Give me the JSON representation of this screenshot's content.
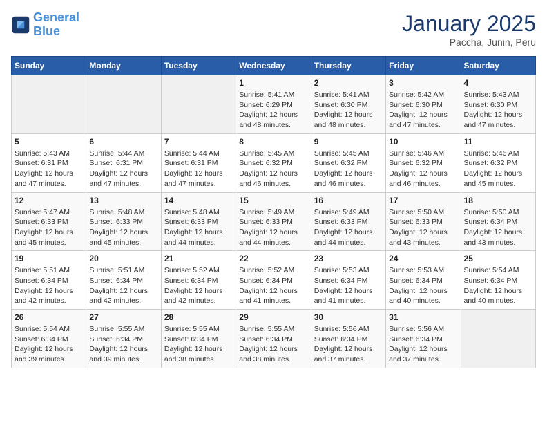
{
  "header": {
    "logo_line1": "General",
    "logo_line2": "Blue",
    "month": "January 2025",
    "location": "Paccha, Junin, Peru"
  },
  "days_of_week": [
    "Sunday",
    "Monday",
    "Tuesday",
    "Wednesday",
    "Thursday",
    "Friday",
    "Saturday"
  ],
  "weeks": [
    [
      {
        "num": "",
        "info": ""
      },
      {
        "num": "",
        "info": ""
      },
      {
        "num": "",
        "info": ""
      },
      {
        "num": "1",
        "info": "Sunrise: 5:41 AM\nSunset: 6:29 PM\nDaylight: 12 hours\nand 48 minutes."
      },
      {
        "num": "2",
        "info": "Sunrise: 5:41 AM\nSunset: 6:30 PM\nDaylight: 12 hours\nand 48 minutes."
      },
      {
        "num": "3",
        "info": "Sunrise: 5:42 AM\nSunset: 6:30 PM\nDaylight: 12 hours\nand 47 minutes."
      },
      {
        "num": "4",
        "info": "Sunrise: 5:43 AM\nSunset: 6:30 PM\nDaylight: 12 hours\nand 47 minutes."
      }
    ],
    [
      {
        "num": "5",
        "info": "Sunrise: 5:43 AM\nSunset: 6:31 PM\nDaylight: 12 hours\nand 47 minutes."
      },
      {
        "num": "6",
        "info": "Sunrise: 5:44 AM\nSunset: 6:31 PM\nDaylight: 12 hours\nand 47 minutes."
      },
      {
        "num": "7",
        "info": "Sunrise: 5:44 AM\nSunset: 6:31 PM\nDaylight: 12 hours\nand 47 minutes."
      },
      {
        "num": "8",
        "info": "Sunrise: 5:45 AM\nSunset: 6:32 PM\nDaylight: 12 hours\nand 46 minutes."
      },
      {
        "num": "9",
        "info": "Sunrise: 5:45 AM\nSunset: 6:32 PM\nDaylight: 12 hours\nand 46 minutes."
      },
      {
        "num": "10",
        "info": "Sunrise: 5:46 AM\nSunset: 6:32 PM\nDaylight: 12 hours\nand 46 minutes."
      },
      {
        "num": "11",
        "info": "Sunrise: 5:46 AM\nSunset: 6:32 PM\nDaylight: 12 hours\nand 45 minutes."
      }
    ],
    [
      {
        "num": "12",
        "info": "Sunrise: 5:47 AM\nSunset: 6:33 PM\nDaylight: 12 hours\nand 45 minutes."
      },
      {
        "num": "13",
        "info": "Sunrise: 5:48 AM\nSunset: 6:33 PM\nDaylight: 12 hours\nand 45 minutes."
      },
      {
        "num": "14",
        "info": "Sunrise: 5:48 AM\nSunset: 6:33 PM\nDaylight: 12 hours\nand 44 minutes."
      },
      {
        "num": "15",
        "info": "Sunrise: 5:49 AM\nSunset: 6:33 PM\nDaylight: 12 hours\nand 44 minutes."
      },
      {
        "num": "16",
        "info": "Sunrise: 5:49 AM\nSunset: 6:33 PM\nDaylight: 12 hours\nand 44 minutes."
      },
      {
        "num": "17",
        "info": "Sunrise: 5:50 AM\nSunset: 6:33 PM\nDaylight: 12 hours\nand 43 minutes."
      },
      {
        "num": "18",
        "info": "Sunrise: 5:50 AM\nSunset: 6:34 PM\nDaylight: 12 hours\nand 43 minutes."
      }
    ],
    [
      {
        "num": "19",
        "info": "Sunrise: 5:51 AM\nSunset: 6:34 PM\nDaylight: 12 hours\nand 42 minutes."
      },
      {
        "num": "20",
        "info": "Sunrise: 5:51 AM\nSunset: 6:34 PM\nDaylight: 12 hours\nand 42 minutes."
      },
      {
        "num": "21",
        "info": "Sunrise: 5:52 AM\nSunset: 6:34 PM\nDaylight: 12 hours\nand 42 minutes."
      },
      {
        "num": "22",
        "info": "Sunrise: 5:52 AM\nSunset: 6:34 PM\nDaylight: 12 hours\nand 41 minutes."
      },
      {
        "num": "23",
        "info": "Sunrise: 5:53 AM\nSunset: 6:34 PM\nDaylight: 12 hours\nand 41 minutes."
      },
      {
        "num": "24",
        "info": "Sunrise: 5:53 AM\nSunset: 6:34 PM\nDaylight: 12 hours\nand 40 minutes."
      },
      {
        "num": "25",
        "info": "Sunrise: 5:54 AM\nSunset: 6:34 PM\nDaylight: 12 hours\nand 40 minutes."
      }
    ],
    [
      {
        "num": "26",
        "info": "Sunrise: 5:54 AM\nSunset: 6:34 PM\nDaylight: 12 hours\nand 39 minutes."
      },
      {
        "num": "27",
        "info": "Sunrise: 5:55 AM\nSunset: 6:34 PM\nDaylight: 12 hours\nand 39 minutes."
      },
      {
        "num": "28",
        "info": "Sunrise: 5:55 AM\nSunset: 6:34 PM\nDaylight: 12 hours\nand 38 minutes."
      },
      {
        "num": "29",
        "info": "Sunrise: 5:55 AM\nSunset: 6:34 PM\nDaylight: 12 hours\nand 38 minutes."
      },
      {
        "num": "30",
        "info": "Sunrise: 5:56 AM\nSunset: 6:34 PM\nDaylight: 12 hours\nand 37 minutes."
      },
      {
        "num": "31",
        "info": "Sunrise: 5:56 AM\nSunset: 6:34 PM\nDaylight: 12 hours\nand 37 minutes."
      },
      {
        "num": "",
        "info": ""
      }
    ]
  ]
}
